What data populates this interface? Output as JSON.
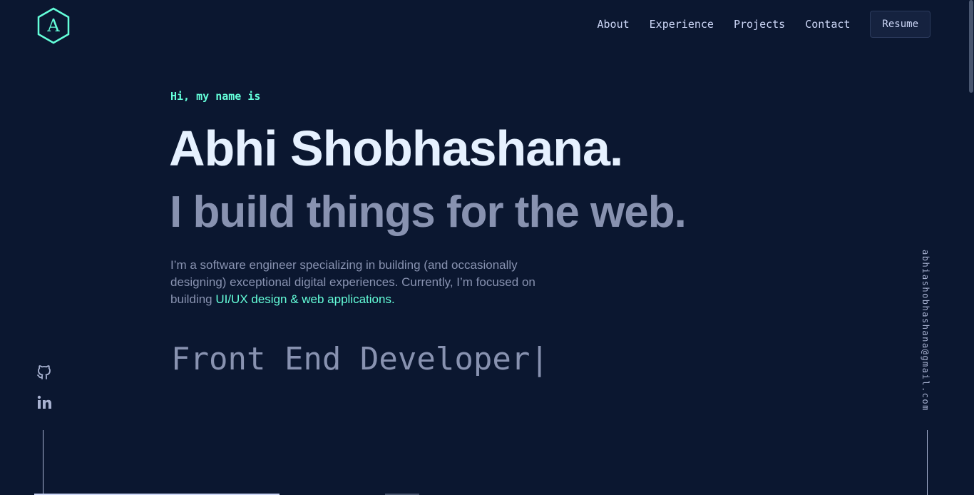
{
  "logo": {
    "letter": "A",
    "icon": "hexagon-logo-icon",
    "color": "#64ffda"
  },
  "nav": {
    "links": [
      "About",
      "Experience",
      "Projects",
      "Contact"
    ],
    "resume_label": "Resume"
  },
  "hero": {
    "intro": "Hi, my name is",
    "name": "Abhi Shobhashana.",
    "tagline": "I build things for the web.",
    "description_text": "I’m a software engineer specializing in building (and occasionally designing) exceptional digital experiences. Currently, I’m focused on building ",
    "description_highlight": "UI/UX design & web applications.",
    "typed_text": "Front End Developer|"
  },
  "social": {
    "icons": [
      "github-icon",
      "linkedin-icon"
    ]
  },
  "email": "abhiashobhashana@gmail.com",
  "colors": {
    "background": "#0b1730",
    "accent": "#64ffda",
    "heading": "#e6f1ff",
    "text": "#8892b0"
  }
}
